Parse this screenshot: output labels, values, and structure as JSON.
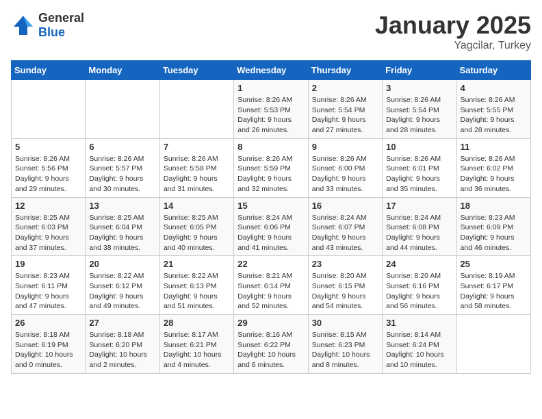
{
  "header": {
    "logo": {
      "general": "General",
      "blue": "Blue"
    },
    "title": "January 2025",
    "location": "Yagcilar, Turkey"
  },
  "weekdays": [
    "Sunday",
    "Monday",
    "Tuesday",
    "Wednesday",
    "Thursday",
    "Friday",
    "Saturday"
  ],
  "weeks": [
    [
      {
        "day": "",
        "info": ""
      },
      {
        "day": "",
        "info": ""
      },
      {
        "day": "",
        "info": ""
      },
      {
        "day": "1",
        "info": "Sunrise: 8:26 AM\nSunset: 5:53 PM\nDaylight: 9 hours and 26 minutes."
      },
      {
        "day": "2",
        "info": "Sunrise: 8:26 AM\nSunset: 5:54 PM\nDaylight: 9 hours and 27 minutes."
      },
      {
        "day": "3",
        "info": "Sunrise: 8:26 AM\nSunset: 5:54 PM\nDaylight: 9 hours and 28 minutes."
      },
      {
        "day": "4",
        "info": "Sunrise: 8:26 AM\nSunset: 5:55 PM\nDaylight: 9 hours and 28 minutes."
      }
    ],
    [
      {
        "day": "5",
        "info": "Sunrise: 8:26 AM\nSunset: 5:56 PM\nDaylight: 9 hours and 29 minutes."
      },
      {
        "day": "6",
        "info": "Sunrise: 8:26 AM\nSunset: 5:57 PM\nDaylight: 9 hours and 30 minutes."
      },
      {
        "day": "7",
        "info": "Sunrise: 8:26 AM\nSunset: 5:58 PM\nDaylight: 9 hours and 31 minutes."
      },
      {
        "day": "8",
        "info": "Sunrise: 8:26 AM\nSunset: 5:59 PM\nDaylight: 9 hours and 32 minutes."
      },
      {
        "day": "9",
        "info": "Sunrise: 8:26 AM\nSunset: 6:00 PM\nDaylight: 9 hours and 33 minutes."
      },
      {
        "day": "10",
        "info": "Sunrise: 8:26 AM\nSunset: 6:01 PM\nDaylight: 9 hours and 35 minutes."
      },
      {
        "day": "11",
        "info": "Sunrise: 8:26 AM\nSunset: 6:02 PM\nDaylight: 9 hours and 36 minutes."
      }
    ],
    [
      {
        "day": "12",
        "info": "Sunrise: 8:25 AM\nSunset: 6:03 PM\nDaylight: 9 hours and 37 minutes."
      },
      {
        "day": "13",
        "info": "Sunrise: 8:25 AM\nSunset: 6:04 PM\nDaylight: 9 hours and 38 minutes."
      },
      {
        "day": "14",
        "info": "Sunrise: 8:25 AM\nSunset: 6:05 PM\nDaylight: 9 hours and 40 minutes."
      },
      {
        "day": "15",
        "info": "Sunrise: 8:24 AM\nSunset: 6:06 PM\nDaylight: 9 hours and 41 minutes."
      },
      {
        "day": "16",
        "info": "Sunrise: 8:24 AM\nSunset: 6:07 PM\nDaylight: 9 hours and 43 minutes."
      },
      {
        "day": "17",
        "info": "Sunrise: 8:24 AM\nSunset: 6:08 PM\nDaylight: 9 hours and 44 minutes."
      },
      {
        "day": "18",
        "info": "Sunrise: 8:23 AM\nSunset: 6:09 PM\nDaylight: 9 hours and 46 minutes."
      }
    ],
    [
      {
        "day": "19",
        "info": "Sunrise: 8:23 AM\nSunset: 6:11 PM\nDaylight: 9 hours and 47 minutes."
      },
      {
        "day": "20",
        "info": "Sunrise: 8:22 AM\nSunset: 6:12 PM\nDaylight: 9 hours and 49 minutes."
      },
      {
        "day": "21",
        "info": "Sunrise: 8:22 AM\nSunset: 6:13 PM\nDaylight: 9 hours and 51 minutes."
      },
      {
        "day": "22",
        "info": "Sunrise: 8:21 AM\nSunset: 6:14 PM\nDaylight: 9 hours and 52 minutes."
      },
      {
        "day": "23",
        "info": "Sunrise: 8:20 AM\nSunset: 6:15 PM\nDaylight: 9 hours and 54 minutes."
      },
      {
        "day": "24",
        "info": "Sunrise: 8:20 AM\nSunset: 6:16 PM\nDaylight: 9 hours and 56 minutes."
      },
      {
        "day": "25",
        "info": "Sunrise: 8:19 AM\nSunset: 6:17 PM\nDaylight: 9 hours and 58 minutes."
      }
    ],
    [
      {
        "day": "26",
        "info": "Sunrise: 8:18 AM\nSunset: 6:19 PM\nDaylight: 10 hours and 0 minutes."
      },
      {
        "day": "27",
        "info": "Sunrise: 8:18 AM\nSunset: 6:20 PM\nDaylight: 10 hours and 2 minutes."
      },
      {
        "day": "28",
        "info": "Sunrise: 8:17 AM\nSunset: 6:21 PM\nDaylight: 10 hours and 4 minutes."
      },
      {
        "day": "29",
        "info": "Sunrise: 8:16 AM\nSunset: 6:22 PM\nDaylight: 10 hours and 6 minutes."
      },
      {
        "day": "30",
        "info": "Sunrise: 8:15 AM\nSunset: 6:23 PM\nDaylight: 10 hours and 8 minutes."
      },
      {
        "day": "31",
        "info": "Sunrise: 8:14 AM\nSunset: 6:24 PM\nDaylight: 10 hours and 10 minutes."
      },
      {
        "day": "",
        "info": ""
      }
    ]
  ]
}
